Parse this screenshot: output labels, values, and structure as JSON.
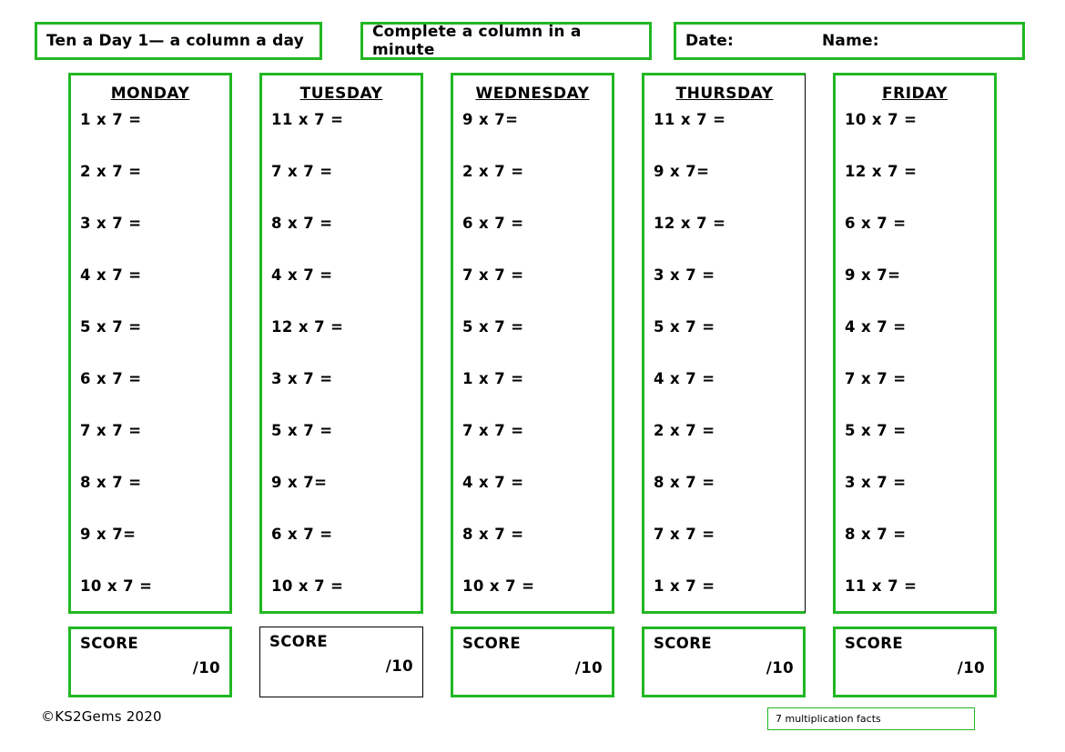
{
  "header": {
    "title": "Ten a Day 1— a column a day",
    "subtitle": "Complete a column in a minute",
    "date_label": "Date:",
    "name_label": "Name:"
  },
  "score": {
    "label": "SCORE",
    "out_of": "/10"
  },
  "footer": {
    "copyright": "©KS2Gems 2020",
    "facts_tag": "7 multiplication facts"
  },
  "colors": {
    "accent_green": "#22b723",
    "ink": "#000000",
    "paper": "#ffffff"
  },
  "columns": [
    {
      "day": "MONDAY",
      "questions": [
        "1 x 7 =",
        "2 x 7 =",
        "3 x 7 =",
        "4 x 7 =",
        "5 x 7 =",
        "6 x 7 =",
        "7 x 7 =",
        "8 x 7 =",
        "9 x 7=",
        "10 x 7 ="
      ]
    },
    {
      "day": "TUESDAY",
      "questions": [
        "11 x 7 =",
        "7 x 7 =",
        "8 x 7 =",
        "4 x 7 =",
        "12 x 7 =",
        "3 x 7 =",
        "5 x 7 =",
        "9 x 7=",
        "6 x 7 =",
        "10 x 7 ="
      ]
    },
    {
      "day": "WEDNESDAY",
      "questions": [
        "9 x 7=",
        "2 x 7 =",
        "6 x 7 =",
        "7 x 7 =",
        "5 x 7 =",
        "1 x 7 =",
        "7 x 7 =",
        "4 x 7 =",
        "8 x 7 =",
        "10 x 7 ="
      ]
    },
    {
      "day": "THURSDAY",
      "questions": [
        "11 x 7 =",
        "9 x 7=",
        "12 x 7 =",
        "3 x 7 =",
        "5 x 7 =",
        "4 x 7 =",
        "2 x 7 =",
        "8 x 7 =",
        "7 x 7 =",
        "1 x 7 ="
      ]
    },
    {
      "day": "FRIDAY",
      "questions": [
        "10 x 7 =",
        "12 x 7 =",
        "6 x 7 =",
        "9 x 7=",
        "4 x 7 =",
        "7 x 7 =",
        "5 x 7 =",
        "3 x 7 =",
        "8 x 7 =",
        "11 x 7 ="
      ]
    }
  ]
}
